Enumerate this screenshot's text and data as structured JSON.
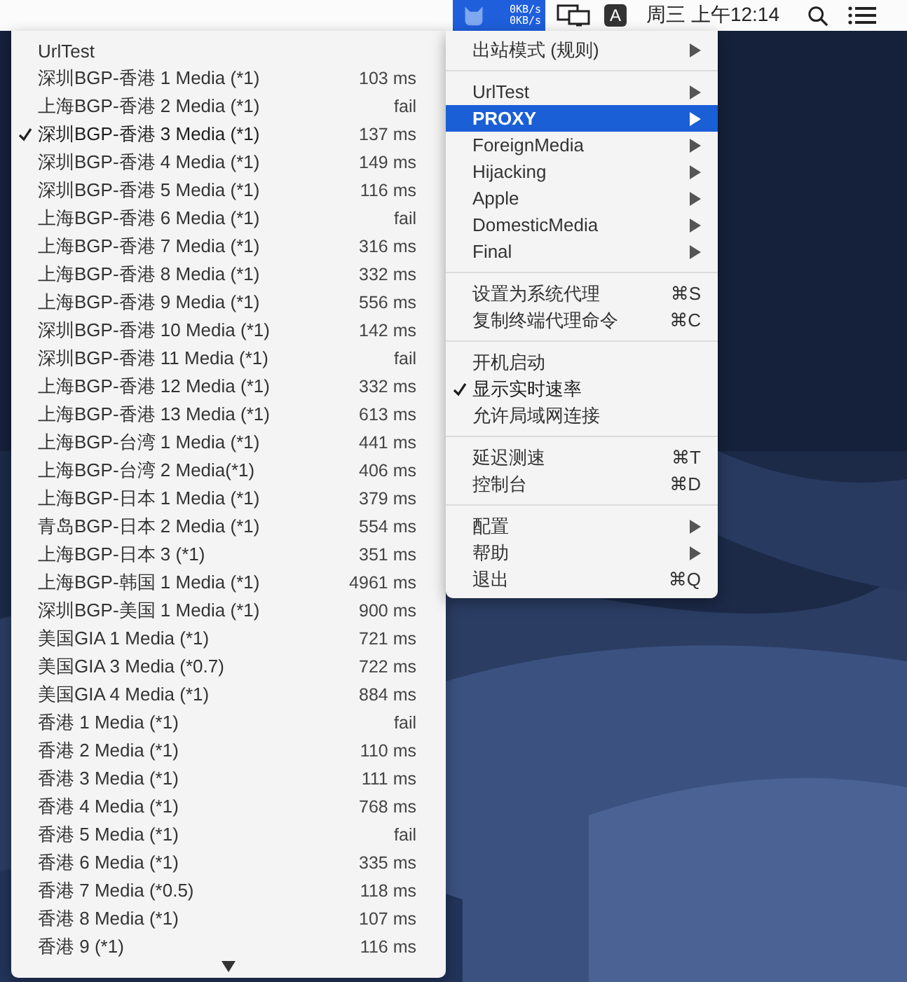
{
  "menu_bar": {
    "upload_speed": "0KB/s",
    "download_speed": "0KB/s",
    "input_source": "A",
    "clock": "周三 上午12:14"
  },
  "proxy_menu": {
    "title": "UrlTest",
    "items": [
      {
        "name": "深圳BGP-香港 1 Media (*1)",
        "latency": "103 ms",
        "selected": false
      },
      {
        "name": "上海BGP-香港 2 Media (*1)",
        "latency": "fail",
        "selected": false
      },
      {
        "name": "深圳BGP-香港 3 Media (*1)",
        "latency": "137 ms",
        "selected": true
      },
      {
        "name": "深圳BGP-香港 4 Media (*1)",
        "latency": "149 ms",
        "selected": false
      },
      {
        "name": "深圳BGP-香港 5 Media (*1)",
        "latency": "116 ms",
        "selected": false
      },
      {
        "name": "上海BGP-香港 6 Media (*1)",
        "latency": "fail",
        "selected": false
      },
      {
        "name": "上海BGP-香港 7 Media (*1)",
        "latency": "316 ms",
        "selected": false
      },
      {
        "name": "上海BGP-香港 8 Media (*1)",
        "latency": "332 ms",
        "selected": false
      },
      {
        "name": "上海BGP-香港 9 Media (*1)",
        "latency": "556 ms",
        "selected": false
      },
      {
        "name": "深圳BGP-香港 10 Media (*1)",
        "latency": "142 ms",
        "selected": false
      },
      {
        "name": "深圳BGP-香港 11 Media (*1)",
        "latency": "fail",
        "selected": false
      },
      {
        "name": "上海BGP-香港 12 Media (*1)",
        "latency": "332 ms",
        "selected": false
      },
      {
        "name": "上海BGP-香港 13 Media (*1)",
        "latency": "613 ms",
        "selected": false
      },
      {
        "name": "上海BGP-台湾 1 Media (*1)",
        "latency": "441 ms",
        "selected": false
      },
      {
        "name": "上海BGP-台湾 2 Media(*1)",
        "latency": "406 ms",
        "selected": false
      },
      {
        "name": "上海BGP-日本 1 Media (*1)",
        "latency": "379 ms",
        "selected": false
      },
      {
        "name": "青岛BGP-日本 2 Media (*1)",
        "latency": "554 ms",
        "selected": false
      },
      {
        "name": "上海BGP-日本 3 (*1)",
        "latency": "351 ms",
        "selected": false
      },
      {
        "name": "上海BGP-韩国 1 Media (*1)",
        "latency": "4961 ms",
        "selected": false
      },
      {
        "name": "深圳BGP-美国 1 Media (*1)",
        "latency": "900 ms",
        "selected": false
      },
      {
        "name": "美国GIA 1 Media (*1)",
        "latency": "721 ms",
        "selected": false
      },
      {
        "name": "美国GIA 3 Media (*0.7)",
        "latency": "722 ms",
        "selected": false
      },
      {
        "name": "美国GIA 4 Media (*1)",
        "latency": "884 ms",
        "selected": false
      },
      {
        "name": "香港 1 Media (*1)",
        "latency": "fail",
        "selected": false
      },
      {
        "name": "香港 2 Media (*1)",
        "latency": "110 ms",
        "selected": false
      },
      {
        "name": "香港 3 Media (*1)",
        "latency": "111 ms",
        "selected": false
      },
      {
        "name": "香港 4 Media (*1)",
        "latency": "768 ms",
        "selected": false
      },
      {
        "name": "香港 5 Media (*1)",
        "latency": "fail",
        "selected": false
      },
      {
        "name": "香港 6 Media (*1)",
        "latency": "335 ms",
        "selected": false
      },
      {
        "name": "香港 7 Media (*0.5)",
        "latency": "118 ms",
        "selected": false
      },
      {
        "name": "香港 8 Media (*1)",
        "latency": "107 ms",
        "selected": false
      },
      {
        "name": "香港 9 (*1)",
        "latency": "116 ms",
        "selected": false
      }
    ]
  },
  "main_menu": {
    "sections": [
      [
        {
          "kind": "submenu",
          "label": "出站模式 (规则)",
          "selected": false
        }
      ],
      [
        {
          "kind": "submenu",
          "label": "UrlTest",
          "selected": false
        },
        {
          "kind": "submenu",
          "label": "PROXY",
          "selected": true
        },
        {
          "kind": "submenu",
          "label": "ForeignMedia",
          "selected": false
        },
        {
          "kind": "submenu",
          "label": "Hijacking",
          "selected": false
        },
        {
          "kind": "submenu",
          "label": "Apple",
          "selected": false
        },
        {
          "kind": "submenu",
          "label": "DomesticMedia",
          "selected": false
        },
        {
          "kind": "submenu",
          "label": "Final",
          "selected": false
        }
      ],
      [
        {
          "kind": "command",
          "label": "设置为系统代理",
          "shortcut": "⌘S",
          "selected": false
        },
        {
          "kind": "command",
          "label": "复制终端代理命令",
          "shortcut": "⌘C",
          "selected": false
        }
      ],
      [
        {
          "kind": "toggle",
          "label": "开机启动",
          "checked": false,
          "selected": false
        },
        {
          "kind": "toggle",
          "label": "显示实时速率",
          "checked": true,
          "selected": false
        },
        {
          "kind": "toggle",
          "label": "允许局域网连接",
          "checked": false,
          "selected": false
        }
      ],
      [
        {
          "kind": "command",
          "label": "延迟测速",
          "shortcut": "⌘T",
          "selected": false
        },
        {
          "kind": "command",
          "label": "控制台",
          "shortcut": "⌘D",
          "selected": false
        }
      ],
      [
        {
          "kind": "submenu",
          "label": "配置",
          "selected": false
        },
        {
          "kind": "submenu",
          "label": "帮助",
          "selected": false
        },
        {
          "kind": "command",
          "label": "退出",
          "shortcut": "⌘Q",
          "selected": false
        }
      ]
    ]
  }
}
